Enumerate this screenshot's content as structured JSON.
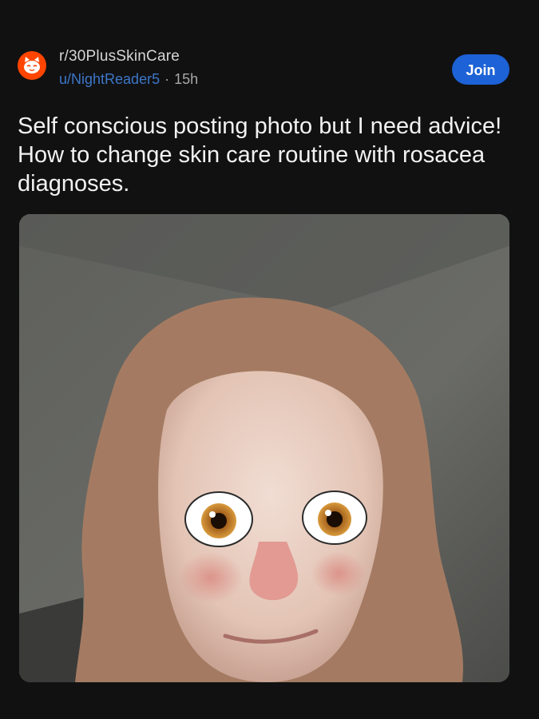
{
  "post": {
    "community": "r/30PlusSkinCare",
    "username": "u/NightReader5",
    "separator": "·",
    "age": "15h",
    "join_label": "Join",
    "title": "Self conscious posting photo but I need advice! How to change skin care routine with rosacea diagnoses."
  },
  "colors": {
    "accent": "#1d62d6",
    "username": "#3c77c8",
    "subreddit_avatar": "#ff4500",
    "background": "#111112"
  },
  "icons": {
    "community_avatar": "snoo-cat-icon"
  }
}
